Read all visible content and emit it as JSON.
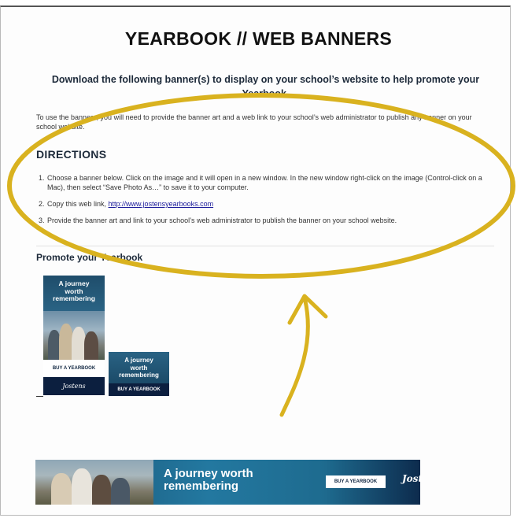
{
  "page": {
    "title": "YEARBOOK // WEB BANNERS",
    "subtitle": "Download the following banner(s) to display on your school’s website to help promote your Yearbook.",
    "intro": "To use the banners, you will need to provide the banner art and a web link to your school’s web administrator to publish any banner on your school website."
  },
  "directions": {
    "heading": "DIRECTIONS",
    "steps": [
      {
        "num": "1.",
        "text": "Choose a banner below.  Click on the image and it will open in a new window.  In the new window right-click on the image (Control-click on a Mac), then select “Save Photo As…” to save it to your computer."
      },
      {
        "num": "2.",
        "text": "Copy this web link, ",
        "link": "http://www.jostensyearbooks.com"
      },
      {
        "num": "3.",
        "text": "Provide the banner art and link to your school’s web administrator to publish the banner on your school website."
      }
    ]
  },
  "promote": {
    "heading": "Promote your Yearbook"
  },
  "banners": {
    "tall": {
      "line1": "A journey",
      "line2": "worth",
      "line3": "remembering",
      "button": "BUY A YEARBOOK",
      "logo": "Jostens"
    },
    "small": {
      "line1": "A journey",
      "line2": "worth",
      "line3": "remembering",
      "button": "BUY A YEARBOOK"
    },
    "wide": {
      "line1": "A journey worth",
      "line2": "remembering",
      "button": "BUY A YEARBOOK",
      "logo": "Jostens"
    }
  },
  "colors": {
    "annotation": "#d9b21f",
    "banner_navy": "#0c1f3f",
    "banner_teal": "#2378a0"
  }
}
